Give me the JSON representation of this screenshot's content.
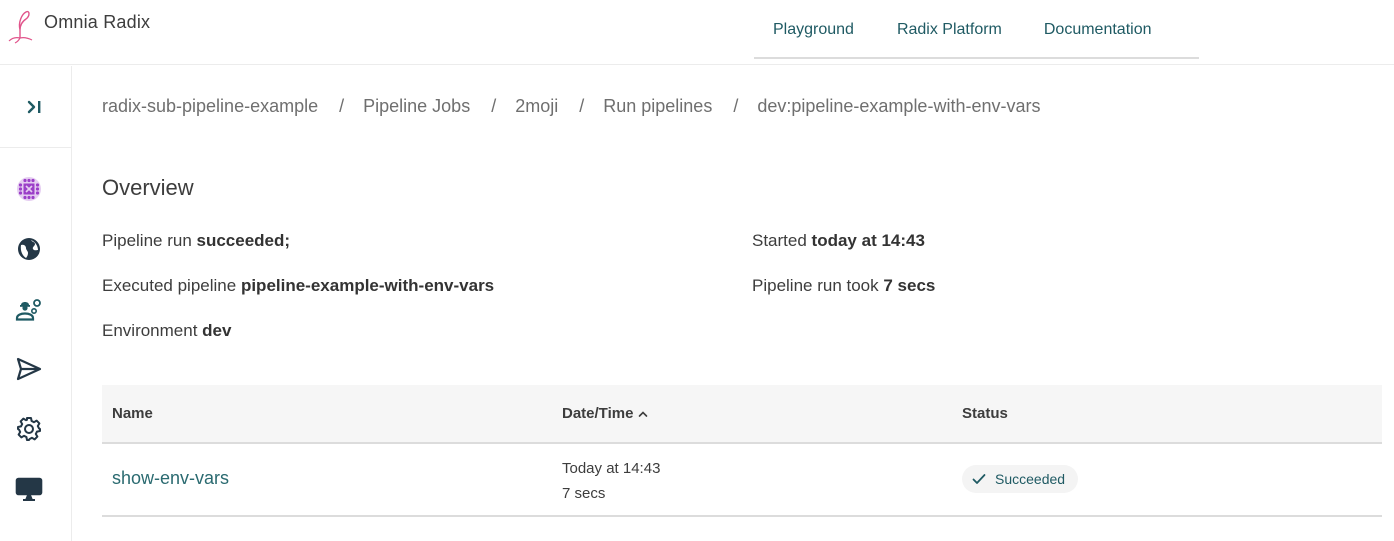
{
  "app": {
    "title": "Omnia Radix",
    "brand_color": "#e1548b",
    "accent_color": "#1f5a63"
  },
  "topnav": {
    "items": [
      {
        "label": "Playground"
      },
      {
        "label": "Radix Platform"
      },
      {
        "label": "Documentation"
      }
    ]
  },
  "sidebar": {
    "toggle_icon": "expand-sidebar-icon",
    "items": [
      {
        "icon": "application-icon",
        "label": "Application"
      },
      {
        "icon": "globe-icon",
        "label": "Environments"
      },
      {
        "icon": "pipeline-jobs-icon",
        "label": "Pipeline Jobs"
      },
      {
        "icon": "send-icon",
        "label": "Deployments"
      },
      {
        "icon": "gear-icon",
        "label": "Configuration"
      },
      {
        "icon": "monitor-icon",
        "label": "Monitoring"
      }
    ]
  },
  "breadcrumb": {
    "items": [
      {
        "label": "radix-sub-pipeline-example"
      },
      {
        "label": "Pipeline Jobs"
      },
      {
        "label": "2moji"
      },
      {
        "label": "Run pipelines"
      },
      {
        "label": "dev:pipeline-example-with-env-vars"
      }
    ],
    "separator": "/"
  },
  "overview": {
    "title": "Overview",
    "status_label": "Pipeline run",
    "status_value": "succeeded;",
    "pipeline_label": "Executed pipeline",
    "pipeline_value": "pipeline-example-with-env-vars",
    "environment_label": "Environment",
    "environment_value": "dev",
    "started_label": "Started",
    "started_value": "today at 14:43",
    "duration_label": "Pipeline run took",
    "duration_value": "7 secs"
  },
  "table": {
    "columns": {
      "name": "Name",
      "datetime": "Date/Time",
      "datetime_sort": "ascending",
      "status": "Status"
    },
    "rows": [
      {
        "name": "show-env-vars",
        "date": "Today at 14:43",
        "duration": "7 secs",
        "status": "Succeeded",
        "status_icon": "check-icon"
      }
    ]
  }
}
